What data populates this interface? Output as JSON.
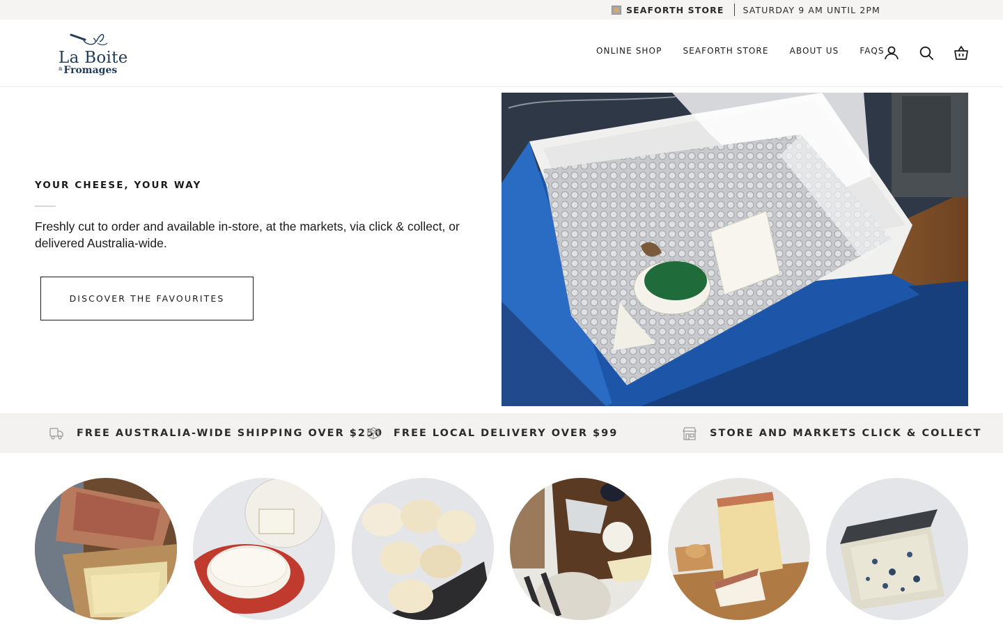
{
  "announcement": {
    "store_label": "SEAFORTH STORE",
    "hours": "SATURDAY 9 AM UNTIL 2PM",
    "icon": "shop-sign-icon"
  },
  "header": {
    "logo_line1": "La Boite",
    "logo_small": "a",
    "logo_line2": "Fromages",
    "nav": [
      {
        "label": "ONLINE SHOP"
      },
      {
        "label": "SEAFORTH STORE"
      },
      {
        "label": "ABOUT US"
      },
      {
        "label": "FAQS"
      }
    ],
    "icons": [
      "account-icon",
      "search-icon",
      "cart-icon"
    ]
  },
  "hero": {
    "eyebrow": "YOUR CHEESE, YOUR WAY",
    "text": "Freshly cut to order and available in-store, at the markets, via click & collect, or delivered Australia-wide.",
    "button_label": "DISCOVER THE FAVOURITES",
    "image": "insulated-cheese-delivery-box"
  },
  "features": [
    {
      "label": "FREE AUSTRALIA-WIDE SHIPPING OVER $250",
      "icon": "delivery-truck-icon"
    },
    {
      "label": "FREE LOCAL DELIVERY OVER $99",
      "icon": "parcel-box-icon"
    },
    {
      "label": "STORE AND MARKETS CLICK & COLLECT",
      "icon": "storefront-icon"
    }
  ],
  "collections": [
    {
      "image": "charcuterie-and-raclette"
    },
    {
      "image": "saint-just-cheese"
    },
    {
      "image": "goat-cheese-crottins"
    },
    {
      "image": "cheese-board-platter"
    },
    {
      "image": "hard-cheese-wedge"
    },
    {
      "image": "blue-cheese-wheel"
    }
  ],
  "colors": {
    "announcement_bg": "#f5f4f2",
    "features_bg": "#f3f2f0",
    "logo_navy": "#1f3a5a",
    "text": "#1a1a1a",
    "box_blue": "#1d56a8"
  }
}
